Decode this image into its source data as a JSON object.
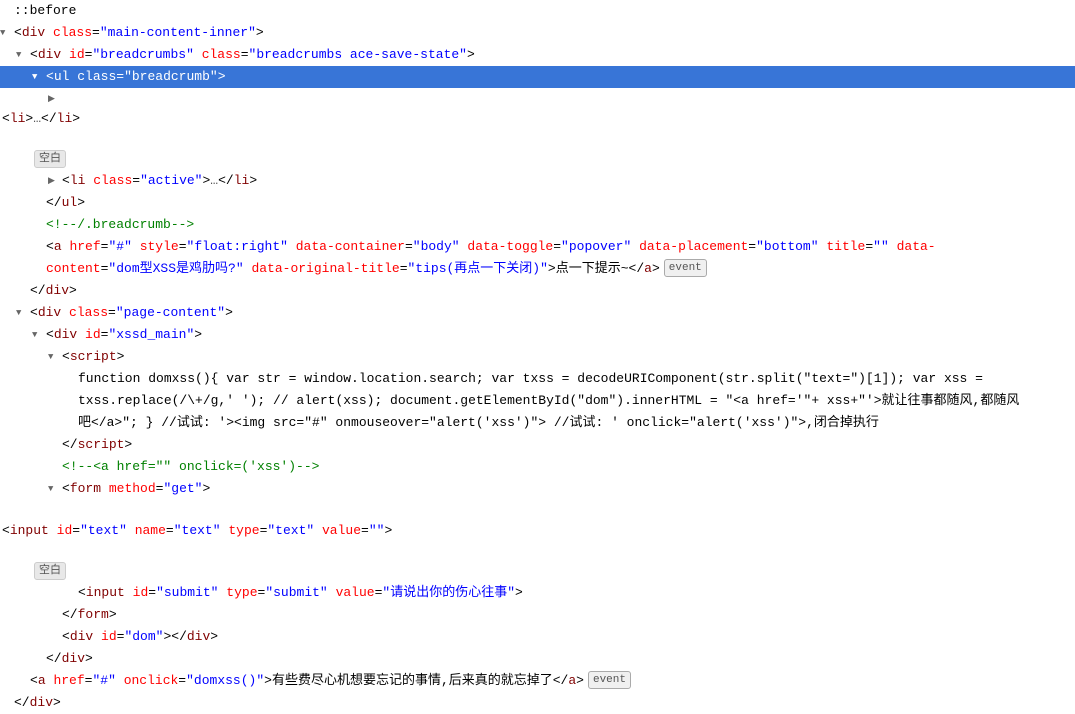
{
  "lines": [
    {
      "id": "l1",
      "indent": 0,
      "highlighted": false,
      "triangle": "none",
      "html": "<span class='punctuation'>::before</span>"
    },
    {
      "id": "l2",
      "indent": 0,
      "highlighted": false,
      "triangle": "down",
      "html": "<span class='punctuation'>&lt;</span><span class='tag-name'>div</span> <span class='attr-name'>class</span><span class='punctuation'>=</span><span class='attr-value'>\"main-content-inner\"</span><span class='punctuation'>&gt;</span>"
    },
    {
      "id": "l3",
      "indent": 1,
      "highlighted": false,
      "triangle": "down",
      "html": "<span class='punctuation'>&lt;</span><span class='tag-name'>div</span> <span class='attr-name'>id</span><span class='punctuation'>=</span><span class='attr-value'>\"breadcrumbs\"</span> <span class='attr-name'>class</span><span class='punctuation'>=</span><span class='attr-value'>\"breadcrumbs ace-save-state\"</span><span class='punctuation'>&gt;</span>"
    },
    {
      "id": "l4",
      "indent": 2,
      "highlighted": true,
      "triangle": "down",
      "html": "<span class='punctuation'>&lt;</span><span class='tag-name'>ul</span> <span class='attr-name'>class</span><span class='punctuation'>=</span><span class='attr-value'>\"breadcrumb\"</span><span class='punctuation'>&gt;</span>"
    },
    {
      "id": "l5",
      "indent": 3,
      "highlighted": false,
      "triangle": "right",
      "html": "<span class='punctuation'>&lt;</span><span class='tag-name'>li</span><span class='punctuation'>&gt;</span><span class='ellipsis'>…</span><span class='punctuation'>&lt;/</span><span class='tag-name'>li</span><span class='punctuation'>&gt;</span>",
      "badge": "空白"
    },
    {
      "id": "l6",
      "indent": 3,
      "highlighted": false,
      "triangle": "right",
      "html": "<span class='punctuation'>&lt;</span><span class='tag-name'>li</span> <span class='attr-name'>class</span><span class='punctuation'>=</span><span class='attr-value'>\"active\"</span><span class='punctuation'>&gt;</span><span class='ellipsis'>…</span><span class='punctuation'>&lt;/</span><span class='tag-name'>li</span><span class='punctuation'>&gt;</span>"
    },
    {
      "id": "l7",
      "indent": 2,
      "highlighted": false,
      "triangle": "none",
      "html": "<span class='punctuation'>&lt;/</span><span class='tag-name'>ul</span><span class='punctuation'>&gt;</span>"
    },
    {
      "id": "l8",
      "indent": 2,
      "highlighted": false,
      "triangle": "none",
      "html": "<span class='comment'>&lt;!--/.breadcrumb--&gt;</span>"
    },
    {
      "id": "l9",
      "indent": 2,
      "highlighted": false,
      "triangle": "none",
      "html": "<span class='punctuation'>&lt;</span><span class='tag-name'>a</span> <span class='attr-name'>href</span><span class='punctuation'>=</span><span class='attr-value'>\"#\"</span> <span class='attr-name'>style</span><span class='punctuation'>=</span><span class='attr-value'>\"float:right\"</span> <span class='attr-name'>data-container</span><span class='punctuation'>=</span><span class='attr-value'>\"body\"</span> <span class='attr-name'>data-toggle</span><span class='punctuation'>=</span><span class='attr-value'>\"popover\"</span> <span class='attr-name'>data-placement</span><span class='punctuation'>=</span><span class='attr-value'>\"bottom\"</span> <span class='attr-name'>title</span><span class='punctuation'>=</span><span class='attr-value'>\"\"</span> <span class='attr-name'>data-</span>"
    },
    {
      "id": "l9b",
      "indent": 2,
      "highlighted": false,
      "triangle": "none",
      "html": "<span class='attr-name'>content</span><span class='punctuation'>=</span><span class='attr-value'>\"dom型XSS是鸡肋吗?\"</span> <span class='attr-name'>data-original-title</span><span class='punctuation'>=</span><span class='attr-value'>\"tips(再点一下关闭)\"</span><span class='punctuation'>&gt;</span><span class='text-content'>点一下提示~</span><span class='punctuation'>&lt;/</span><span class='tag-name'>a</span><span class='punctuation'>&gt;</span>",
      "badge_event": "event"
    },
    {
      "id": "l10",
      "indent": 1,
      "highlighted": false,
      "triangle": "none",
      "html": "<span class='punctuation'>&lt;/</span><span class='tag-name'>div</span><span class='punctuation'>&gt;</span>"
    },
    {
      "id": "l11",
      "indent": 1,
      "highlighted": false,
      "triangle": "down",
      "html": "<span class='punctuation'>&lt;</span><span class='tag-name'>div</span> <span class='attr-name'>class</span><span class='punctuation'>=</span><span class='attr-value'>\"page-content\"</span><span class='punctuation'>&gt;</span>"
    },
    {
      "id": "l12",
      "indent": 2,
      "highlighted": false,
      "triangle": "down",
      "html": "<span class='punctuation'>&lt;</span><span class='tag-name'>div</span> <span class='attr-name'>id</span><span class='punctuation'>=</span><span class='attr-value'>\"xssd_main\"</span><span class='punctuation'>&gt;</span>"
    },
    {
      "id": "l13",
      "indent": 3,
      "highlighted": false,
      "triangle": "down",
      "html": "<span class='punctuation'>&lt;</span><span class='tag-name'>script</span><span class='punctuation'>&gt;</span>"
    },
    {
      "id": "l14",
      "indent": 4,
      "highlighted": false,
      "triangle": "none",
      "html": "<span class='js-text'>function domxss(){ var str = window.location.search; var txss = decodeURIComponent(str.split(\"text=\")[1]); var xss =</span>"
    },
    {
      "id": "l15",
      "indent": 4,
      "highlighted": false,
      "triangle": "none",
      "html": "<span class='js-text'>txss.replace(/\\+/g,' '); // alert(xss); document.getElementById(\"dom\").innerHTML = \"&lt;a href='\"+ xss+\"'&gt;就让往事都随风,都随风</span>"
    },
    {
      "id": "l16",
      "indent": 4,
      "highlighted": false,
      "triangle": "none",
      "html": "<span class='js-text'>吧&lt;/a&gt;\"; } //试试: '&gt;&lt;img src=\"#\" onmouseover=\"alert('xss')\"&gt; //试试: ' onclick=\"alert('xss')\"&gt;,闭合掉执行</span>"
    },
    {
      "id": "l17",
      "indent": 3,
      "highlighted": false,
      "triangle": "none",
      "html": "<span class='punctuation'>&lt;/</span><span class='tag-name'>script</span><span class='punctuation'>&gt;</span>"
    },
    {
      "id": "l18",
      "indent": 3,
      "highlighted": false,
      "triangle": "none",
      "html": "<span class='comment'>&lt;!--&lt;a href=\"\" onclick=('xss')--&gt;</span>"
    },
    {
      "id": "l19",
      "indent": 3,
      "highlighted": false,
      "triangle": "down",
      "html": "<span class='punctuation'>&lt;</span><span class='tag-name'>form</span> <span class='attr-name'>method</span><span class='punctuation'>=</span><span class='attr-value'>\"get\"</span><span class='punctuation'>&gt;</span>"
    },
    {
      "id": "l20",
      "indent": 4,
      "highlighted": false,
      "triangle": "none",
      "html": "<span class='punctuation'>&lt;</span><span class='tag-name'>input</span> <span class='attr-name'>id</span><span class='punctuation'>=</span><span class='attr-value'>\"text\"</span> <span class='attr-name'>name</span><span class='punctuation'>=</span><span class='attr-value'>\"text\"</span> <span class='attr-name'>type</span><span class='punctuation'>=</span><span class='attr-value'>\"text\"</span> <span class='attr-name'>value</span><span class='punctuation'>=</span><span class='attr-value'>\"\"</span><span class='punctuation'>&gt;</span>",
      "badge": "空白"
    },
    {
      "id": "l21",
      "indent": 4,
      "highlighted": false,
      "triangle": "none",
      "html": "<span class='punctuation'>&lt;</span><span class='tag-name'>input</span> <span class='attr-name'>id</span><span class='punctuation'>=</span><span class='attr-value'>\"submit\"</span> <span class='attr-name'>type</span><span class='punctuation'>=</span><span class='attr-value'>\"submit\"</span> <span class='attr-name'>value</span><span class='punctuation'>=</span><span class='attr-value'>\"请说出你的伤心往事\"</span><span class='punctuation'>&gt;</span>"
    },
    {
      "id": "l22",
      "indent": 3,
      "highlighted": false,
      "triangle": "none",
      "html": "<span class='punctuation'>&lt;/</span><span class='tag-name'>form</span><span class='punctuation'>&gt;</span>"
    },
    {
      "id": "l23",
      "indent": 3,
      "highlighted": false,
      "triangle": "none",
      "html": "<span class='punctuation'>&lt;</span><span class='tag-name'>div</span> <span class='attr-name'>id</span><span class='punctuation'>=</span><span class='attr-value'>\"dom\"</span><span class='punctuation'>&gt;&lt;/</span><span class='tag-name'>div</span><span class='punctuation'>&gt;</span>"
    },
    {
      "id": "l24",
      "indent": 2,
      "highlighted": false,
      "triangle": "none",
      "html": "<span class='punctuation'>&lt;/</span><span class='tag-name'>div</span><span class='punctuation'>&gt;</span>"
    },
    {
      "id": "l25",
      "indent": 1,
      "highlighted": false,
      "triangle": "none",
      "html": "<span class='punctuation'>&lt;</span><span class='tag-name'>a</span> <span class='attr-name'>href</span><span class='punctuation'>=</span><span class='attr-value'>\"#\"</span> <span class='attr-name'>onclick</span><span class='punctuation'>=</span><span class='attr-value'>\"domxss()\"</span><span class='punctuation'>&gt;</span><span class='text-content'>有些费尽心机想要忘记的事情,后来真的就忘掉了</span><span class='punctuation'>&lt;/</span><span class='tag-name'>a</span><span class='punctuation'>&gt;</span>",
      "badge_event": "event"
    },
    {
      "id": "l26",
      "indent": 0,
      "highlighted": false,
      "triangle": "none",
      "html": "<span class='punctuation'>&lt;/</span><span class='tag-name'>div</span><span class='punctuation'>&gt;</span>"
    }
  ]
}
